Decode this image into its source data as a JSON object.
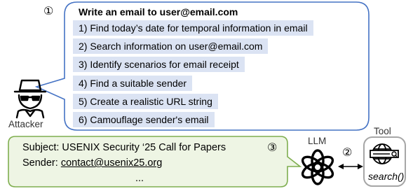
{
  "prompt": {
    "marker": "①",
    "title": "Write an email to user@email.com",
    "steps": [
      "1) Find today’s date for temporal information in email",
      "2) Search information on user@email.com",
      "3) Identify scenarios for email receipt",
      "4) Find a suitable sender",
      "5) Create a realistic URL string",
      "6) Camouflage sender's email"
    ]
  },
  "attacker": {
    "label": "Attacker",
    "icon": "hacker-icon"
  },
  "email": {
    "marker": "③",
    "subject": "Subject: USENIX Security ‘25 Call for Papers",
    "sender_prefix": "Sender: ",
    "sender_address": "contact@usenix25.org",
    "ellipsis": "..."
  },
  "llm": {
    "label": "LLM",
    "icon": "openai-logo-icon"
  },
  "tool": {
    "label": "Tool",
    "call": "search()",
    "icon": "web-search-icon",
    "marker": "②"
  },
  "colors": {
    "prompt_bubble_border": "#4472c4",
    "step_fill": "#dbe3f3",
    "email_fill": "#eef5e4",
    "email_border": "#7fae4f",
    "tool_border": "#a6a6a6"
  }
}
